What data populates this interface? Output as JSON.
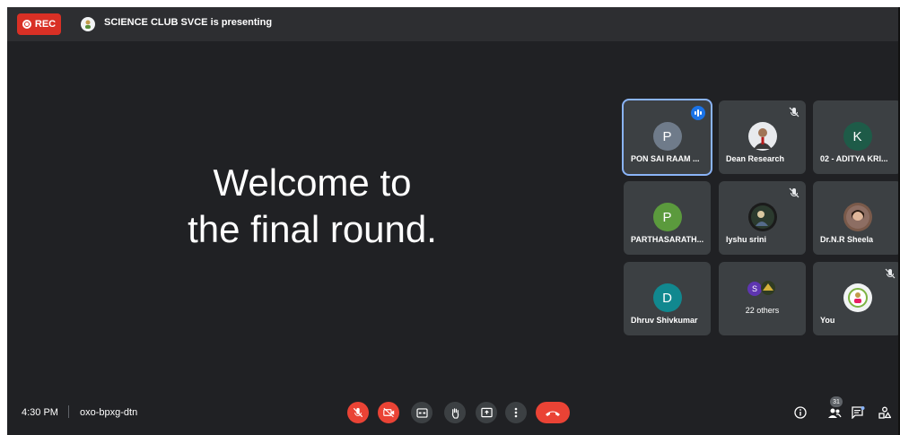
{
  "topbar": {
    "rec_label": "REC",
    "presenting_text": "SCIENCE CLUB SVCE is presenting"
  },
  "slide": {
    "line1": "Welcome to",
    "line2": "the final round."
  },
  "participants": [
    {
      "name": "PON SAI RAAM ...",
      "initial": "P",
      "avatar_color": "#6f7b8a",
      "muted": false,
      "speaking": true
    },
    {
      "name": "Dean Research",
      "initial": "",
      "avatar_color": "#e8eaed",
      "muted": true,
      "speaking": false
    },
    {
      "name": "02 - ADITYA KRI...",
      "initial": "K",
      "avatar_color": "#1e5b48",
      "muted": false,
      "speaking": false
    },
    {
      "name": "PARTHASARATH...",
      "initial": "P",
      "avatar_color": "#5b9a3d",
      "muted": false,
      "speaking": false
    },
    {
      "name": "Iyshu srini",
      "initial": "",
      "avatar_color": "#222",
      "muted": true,
      "speaking": false
    },
    {
      "name": "Dr.N.R Sheela",
      "initial": "",
      "avatar_color": "#7a5a4a",
      "muted": false,
      "speaking": false
    },
    {
      "name": "Dhruv Shivkumar",
      "initial": "D",
      "avatar_color": "#11888f",
      "muted": false,
      "speaking": false
    },
    {
      "name": "22 others",
      "initial": "S",
      "avatar_color": "#5e35b1",
      "muted": false,
      "speaking": false
    },
    {
      "name": "You",
      "initial": "",
      "avatar_color": "#f1f3f4",
      "muted": true,
      "speaking": false
    }
  ],
  "bottombar": {
    "time": "4:30 PM",
    "meeting_code": "oxo-bpxg-dtn",
    "participant_count": "31"
  },
  "colors": {
    "background": "#202124",
    "tile": "#3c4043",
    "accent_red": "#ea4335",
    "active_outline": "#8ab4f8"
  }
}
